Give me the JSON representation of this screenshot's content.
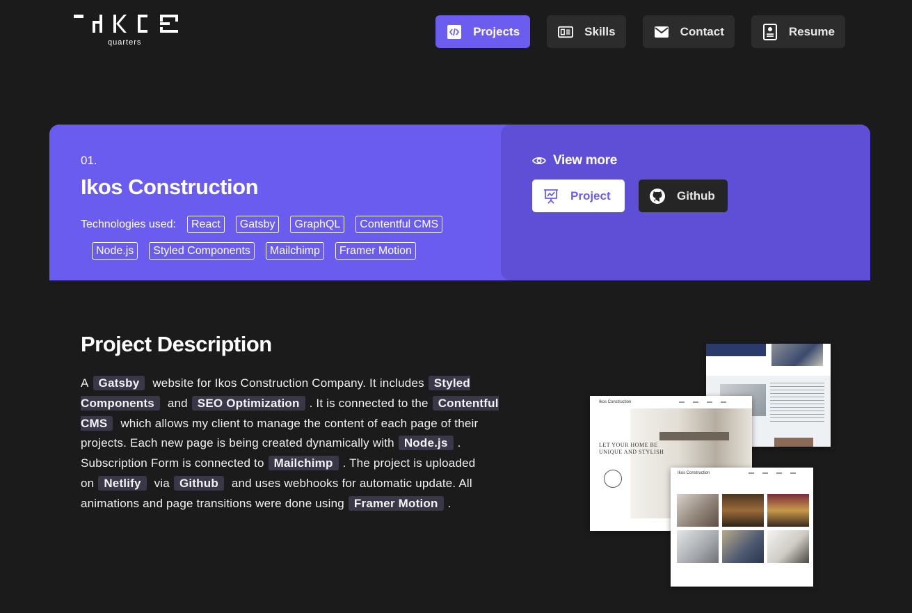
{
  "logo": {
    "subtitle": "quarters"
  },
  "nav": [
    {
      "label": "Projects",
      "icon": "code-icon",
      "active": true
    },
    {
      "label": "Skills",
      "icon": "list-icon",
      "active": false
    },
    {
      "label": "Contact",
      "icon": "mail-icon",
      "active": false
    },
    {
      "label": "Resume",
      "icon": "document-icon",
      "active": false
    }
  ],
  "hero": {
    "number": "01.",
    "title": "Ikos Construction",
    "tech_label": "Technologies used:",
    "technologies": [
      "React",
      "Gatsby",
      "GraphQL",
      "Contentful CMS",
      "Node.js",
      "Styled Components",
      "Mailchimp",
      "Framer Motion"
    ],
    "view_more": "View more",
    "project_button": "Project",
    "github_button": "Github"
  },
  "description": {
    "title": "Project Description",
    "parts": [
      "A",
      "Gatsby",
      "website for Ikos Construction Company. It includes",
      "Styled Components",
      "and",
      "SEO Optimization",
      ". It is connected to the",
      "Contentful CMS",
      "which allows my client to manage the content of each page of their projects. Each new page is being created dynamically with",
      "Node.js",
      ". Subscription Form is connected to",
      "Mailchimp",
      ". The project is uploaded on",
      "Netlify",
      "via",
      "Github",
      "and uses webhooks for automatic update. All animations and page transitions were done using",
      "Framer Motion",
      "."
    ]
  },
  "preview": {
    "site_name_1": "Ikos Construction",
    "site_name_2": "Ikos Construction",
    "hero_line_1": "LET YOUR HOME BE",
    "hero_line_2": "UNIQUE AND STYLISH"
  },
  "colors": {
    "accent": "#6b5cf0",
    "accent_dark": "#5e4fd6",
    "background": "#1b1b1b",
    "button": "#2c2c2c"
  }
}
